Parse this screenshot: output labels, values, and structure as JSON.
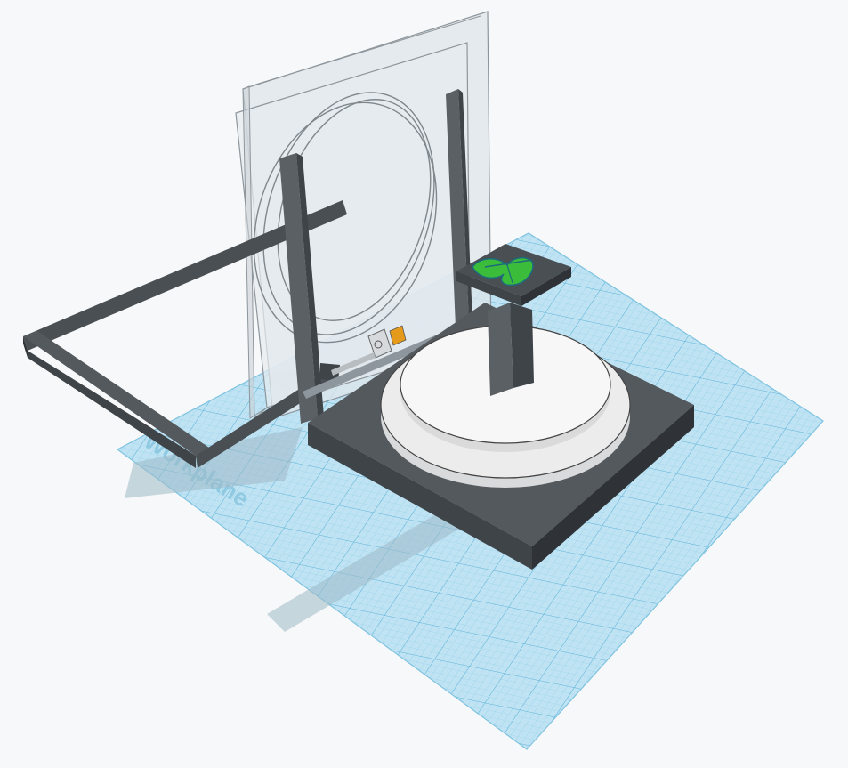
{
  "workplane": {
    "label": "Workplane"
  },
  "colors": {
    "background": "#f7f8f9",
    "grid_fill": "#bfe3f3",
    "grid_line": "#8ccbe6",
    "grid_line_major": "#5fb3d8",
    "base_dark": "#54595e",
    "base_darker": "#3f4449",
    "base_side": "#2f3337",
    "turntable_light": "#ececec",
    "turntable_top": "#f7f7f7",
    "glass": "#dfe5ea",
    "glass_edge": "#8d969c",
    "leaf": "#3bbd3b",
    "leaf_outline": "#1d6b7a",
    "motor_accent": "#e69a1c"
  },
  "icons": {
    "leaf": "leaf-icon",
    "motor": "motor-icon"
  }
}
